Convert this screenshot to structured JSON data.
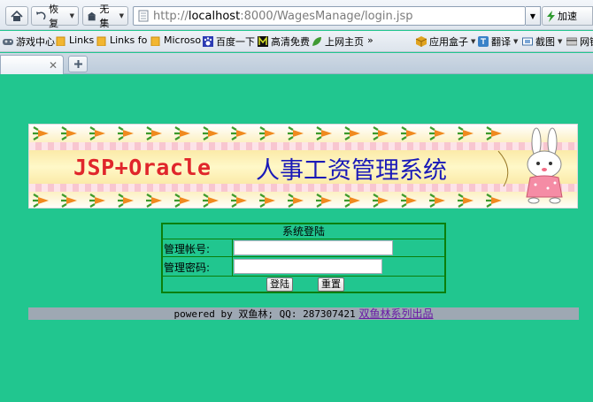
{
  "browser": {
    "nav": {
      "restore_label": "恢复",
      "nofocus_label": "无集"
    },
    "address": {
      "prefix": "http://",
      "host": "localhost",
      "rest": ":8000/WagesManage/login.jsp"
    },
    "accelerate_label": "加速",
    "bookmarks": [
      {
        "label": "游戏中心"
      },
      {
        "label": "Links"
      },
      {
        "label": "Links fo"
      },
      {
        "label": "Microso"
      },
      {
        "label": "百度一下"
      },
      {
        "label": "高清免费"
      },
      {
        "label": "上网主页"
      }
    ],
    "bookmarks_overflow": "»",
    "right_tools": [
      {
        "label": "应用盒子"
      },
      {
        "label": "翻译"
      },
      {
        "label": "截图"
      },
      {
        "label": "网银"
      }
    ]
  },
  "page": {
    "banner": {
      "title_latin": "JSP+Oracle",
      "title_cn": "人事工资管理系统"
    },
    "login": {
      "title": "系统登陆",
      "username_label": "管理帐号:",
      "password_label": "管理密码:",
      "username_value": "",
      "password_value": "",
      "login_button": "登陆",
      "reset_button": "重置"
    },
    "footer": {
      "powered_text": "powered by 双鱼林; QQ: 287307421",
      "link_text": "双鱼林系列出品"
    }
  },
  "colors": {
    "page_background": "#21c68f",
    "table_border": "#0b7f0b",
    "footer_background": "#9ea8b3",
    "link_color": "#6a1aa5",
    "title_red": "#e0262b",
    "title_blue": "#1a1ab8"
  }
}
